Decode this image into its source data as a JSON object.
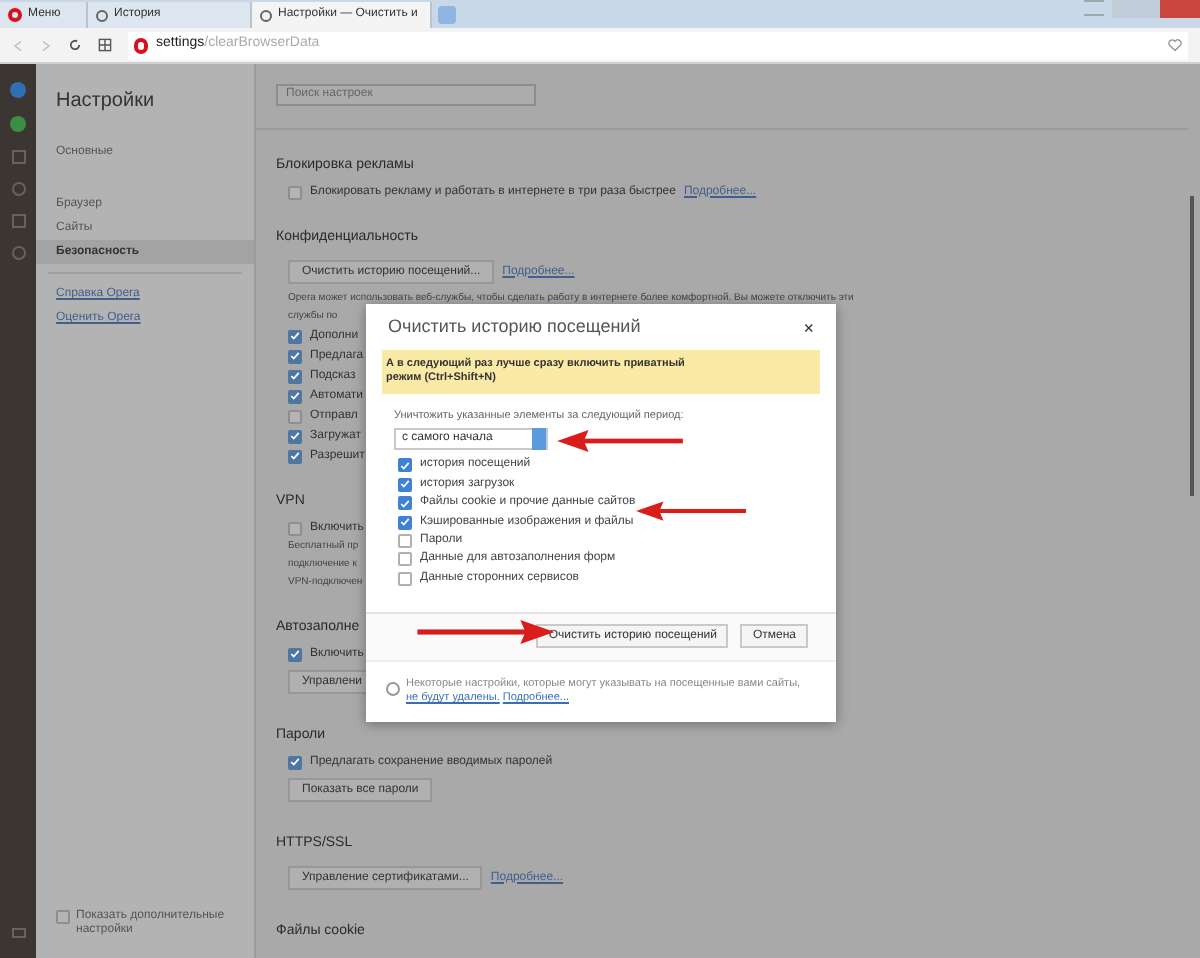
{
  "browser": {
    "tabs": [
      {
        "label": "Меню",
        "selected": false,
        "kind": "menu"
      },
      {
        "label": "История",
        "selected": false,
        "kind": "page"
      },
      {
        "label": "Настройки — Очистить и",
        "selected": true,
        "kind": "page"
      }
    ],
    "address": {
      "host": "settings",
      "path": "/clearBrowserData"
    }
  },
  "sidebar": {
    "title": "Настройки",
    "items": [
      {
        "label": "Основные",
        "selected": false
      },
      {
        "label": "Браузер",
        "selected": false
      },
      {
        "label": "Сайты",
        "selected": false
      },
      {
        "label": "Безопасность",
        "selected": true
      }
    ],
    "links": [
      "Справка Opera",
      "Оценить Opera"
    ],
    "advanced": {
      "label": "Показать дополнительные настройки",
      "checked": false
    }
  },
  "settings": {
    "search_placeholder": "Поиск настроек",
    "sections": [
      {
        "title": "Блокировка рекламы",
        "rows": [
          {
            "kind": "checkbox",
            "label": "Блокировать рекламу и работать в интернете в три раза быстрее",
            "checked": false,
            "link": "Подробнее..."
          }
        ]
      },
      {
        "title": "Конфиденциальность",
        "rows": [
          {
            "kind": "button",
            "label": "Очистить историю посещений...",
            "link": "Подробнее..."
          },
          {
            "kind": "note",
            "text": "Opera может использовать веб-службы, чтобы сделать работу в интернете более комфортной. Вы можете отключить эти"
          },
          {
            "kind": "note",
            "text": "службы по"
          },
          {
            "kind": "checkbox",
            "label": "Дополни",
            "checked": true
          },
          {
            "kind": "checkbox",
            "label": "Предлага",
            "checked": true
          },
          {
            "kind": "checkbox",
            "label": "Подсказ",
            "checked": true
          },
          {
            "kind": "checkbox",
            "label": "Автомати",
            "checked": true
          },
          {
            "kind": "checkbox",
            "label": "Отправл",
            "checked": false
          },
          {
            "kind": "checkbox",
            "label": "Загружат",
            "checked": true
          },
          {
            "kind": "checkbox",
            "label": "Разрешит",
            "checked": true
          }
        ]
      },
      {
        "title": "VPN",
        "rows": [
          {
            "kind": "checkbox",
            "label": "Включить",
            "checked": false
          },
          {
            "kind": "note",
            "text": "Бесплатный пр"
          },
          {
            "kind": "note",
            "text": "подключение к"
          },
          {
            "kind": "note",
            "text": "VPN-подключен"
          }
        ]
      },
      {
        "title": "Автозаполне",
        "rows": [
          {
            "kind": "checkbox",
            "label": "Включить",
            "checked": true
          },
          {
            "kind": "button",
            "label": "Управлени"
          }
        ]
      },
      {
        "title": "Пароли",
        "rows": [
          {
            "kind": "checkbox",
            "label": "Предлагать сохранение вводимых паролей",
            "checked": true
          },
          {
            "kind": "button",
            "label": "Показать все пароли"
          }
        ]
      },
      {
        "title": "HTTPS/SSL",
        "rows": [
          {
            "kind": "button",
            "label": "Управление сертификатами...",
            "link": "Подробнее..."
          }
        ]
      },
      {
        "title": "Файлы cookie"
      }
    ]
  },
  "dialog": {
    "title": "Очистить историю посещений",
    "close": "×",
    "banner": "А в следующий раз лучше сразу включить приватный режим (Ctrl+Shift+N)",
    "period_label": "Уничтожить указанные элементы за следующий период:",
    "period": "с самого начала",
    "items": [
      {
        "label": "история посещений",
        "checked": true
      },
      {
        "label": "история загрузок",
        "checked": true
      },
      {
        "label": "Файлы cookie и прочие данные сайтов",
        "checked": true
      },
      {
        "label": "Кэшированные изображения и файлы",
        "checked": true
      },
      {
        "label": "Пароли",
        "checked": false
      },
      {
        "label": "Данные для автозаполнения форм",
        "checked": false
      },
      {
        "label": "Данные сторонних сервисов",
        "checked": false
      }
    ],
    "buttons": [
      "Очистить историю посещений",
      "Отмена"
    ],
    "footnote": {
      "text": "Некоторые настройки, которые могут указывать на посещенные вами сайты,",
      "link1": "не будут удалены.",
      "link2": "Подробнее..."
    }
  }
}
